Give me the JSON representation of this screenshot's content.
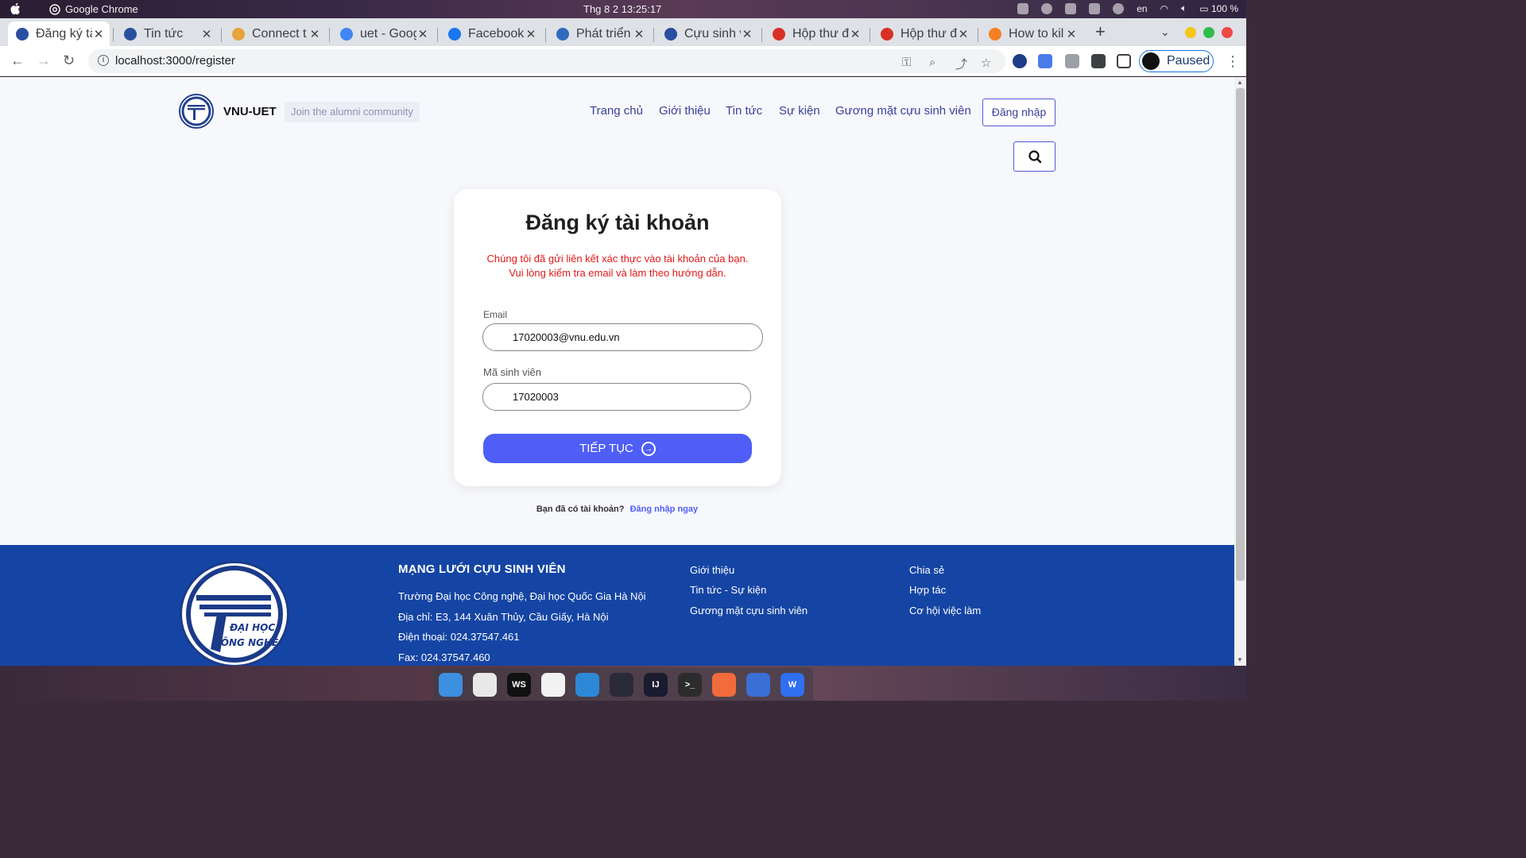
{
  "os": {
    "app_name": "Google Chrome",
    "clock": "Thg 8 2  13:25:17",
    "lang": "en",
    "battery": "100 %"
  },
  "tabs": [
    {
      "label": "Đăng ký tà",
      "icon": "uet-logo-icon",
      "color": "#2a4ea0"
    },
    {
      "label": "Tin tức",
      "icon": "uet-logo-icon",
      "color": "#2a4ea0"
    },
    {
      "label": "Connect t",
      "icon": "package-icon",
      "color": "#e8a33c"
    },
    {
      "label": "uet - Goog",
      "icon": "google-icon",
      "color": "#4285f4"
    },
    {
      "label": "Facebook",
      "icon": "facebook-icon",
      "color": "#1877f2"
    },
    {
      "label": "Phát triển",
      "icon": "vue-icon",
      "color": "#2f6bbd"
    },
    {
      "label": "Cựu sinh v",
      "icon": "uet-logo-icon",
      "color": "#2a4ea0"
    },
    {
      "label": "Hộp thư đ",
      "icon": "gmail-icon",
      "color": "#d93025"
    },
    {
      "label": "Hộp thư đ",
      "icon": "gmail-icon",
      "color": "#d93025"
    },
    {
      "label": "How to kil",
      "icon": "stackoverflow-icon",
      "color": "#f48024"
    }
  ],
  "tab_close": "✕",
  "new_tab": "+",
  "toolbar": {
    "url": "localhost:3000/register",
    "profile_label": "Paused"
  },
  "site": {
    "brand": "VNU-UET",
    "tagline": "Join the alumni community",
    "nav": [
      "Trang chủ",
      "Giới thiệu",
      "Tin tức",
      "Sự kiện",
      "Gương mặt cựu sinh viên"
    ],
    "login_label": "Đăng nhập"
  },
  "form": {
    "title": "Đăng ký tài khoản",
    "message_line1": "Chúng tôi đã gửi liên kết xác thực vào tài khoản của bạn.",
    "message_line2": "Vui lòng kiểm tra email và làm theo hướng dẫn.",
    "email_label": "Email",
    "email_value": "17020003@vnu.edu.vn",
    "student_id_label": "Mã sinh viên",
    "student_id_value": "17020003",
    "submit_label": "TIẾP TỤC"
  },
  "have_account": {
    "text": "Bạn đã có tài khoản?",
    "link": "Đăng nhập ngay"
  },
  "footer": {
    "title": "MẠNG LƯỚI CỰU SINH VIÊN",
    "lines": [
      "Trường Đại học Công nghệ, Đại học Quốc Gia Hà Nội",
      "Địa chỉ: E3, 144 Xuân Thủy, Cầu Giấy, Hà Nội",
      "Điện thoại: 024.37547.461",
      "Fax: 024.37547.460"
    ],
    "links_col1": [
      "Giới thiệu",
      "Tin tức - Sự kiện",
      "Gương mặt cựu sinh viên"
    ],
    "links_col2": [
      "Chia sẻ",
      "Hợp tác",
      "Cơ hội việc làm"
    ],
    "logo_text_1": "ĐẠI HỌC",
    "logo_text_2": "CÔNG NGHỆ"
  },
  "dock": [
    {
      "name": "finder-icon",
      "color": "#3d8fe0",
      "text": ""
    },
    {
      "name": "chrome-icon",
      "color": "#e8e8e8",
      "text": ""
    },
    {
      "name": "webstorm-icon",
      "color": "#111111",
      "text": "WS"
    },
    {
      "name": "inkscape-icon",
      "color": "#f2f2f2",
      "text": ""
    },
    {
      "name": "shotwell-icon",
      "color": "#2d89d8",
      "text": ""
    },
    {
      "name": "vscode-icon",
      "color": "#2a2a3a",
      "text": ""
    },
    {
      "name": "intellij-icon",
      "color": "#1b1b2f",
      "text": "IJ"
    },
    {
      "name": "terminal-icon",
      "color": "#2c2c2c",
      "text": ">_"
    },
    {
      "name": "postman-icon",
      "color": "#f26b3a",
      "text": ""
    },
    {
      "name": "timeshift-icon",
      "color": "#3a6fd6",
      "text": ""
    },
    {
      "name": "wps-icon",
      "color": "#2f6ff0",
      "text": "W"
    }
  ]
}
